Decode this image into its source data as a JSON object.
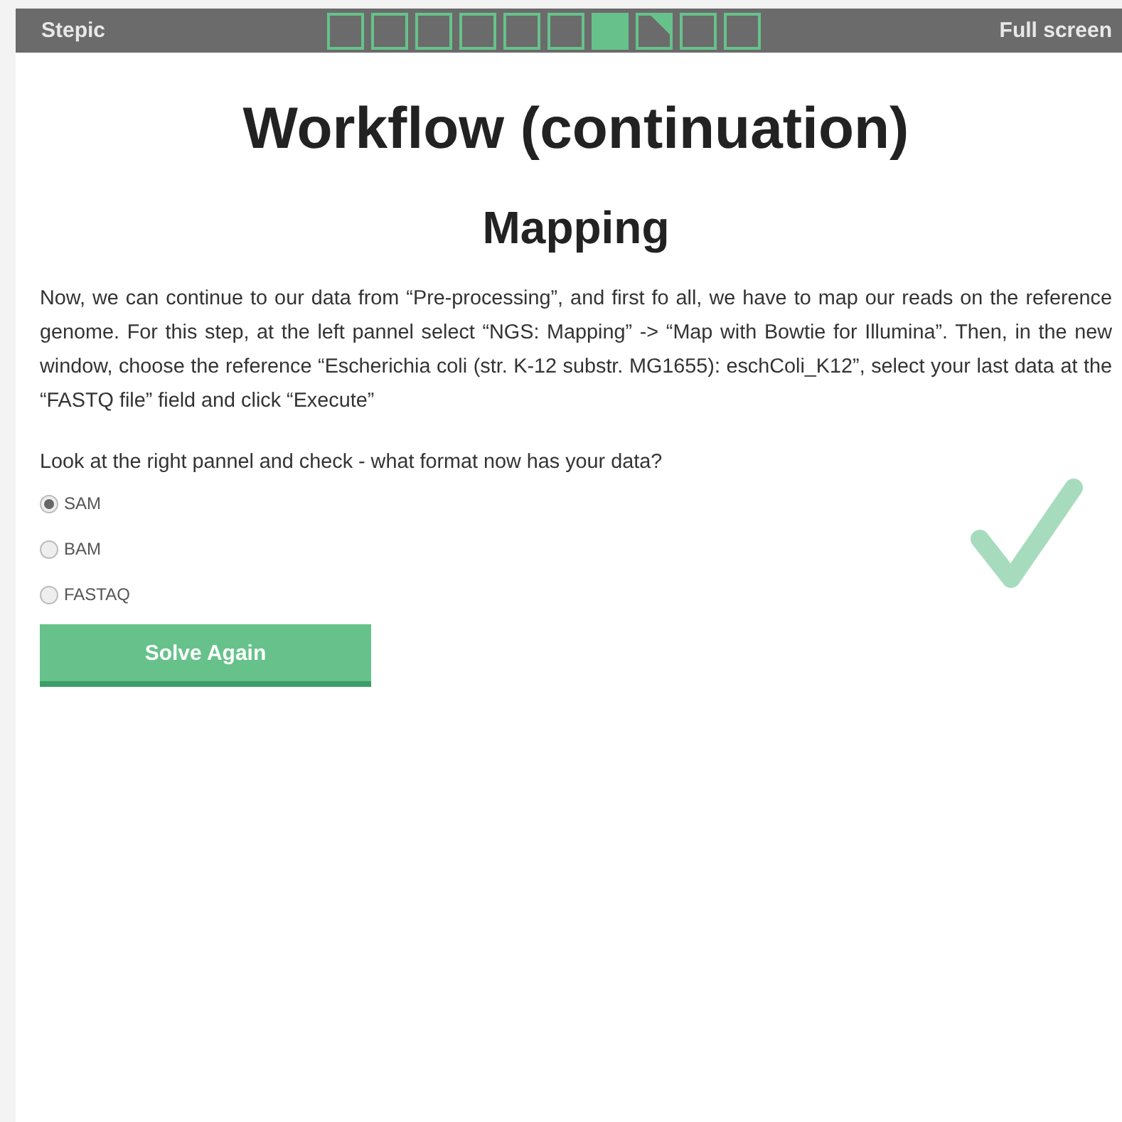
{
  "header": {
    "brand": "Stepic",
    "steps": [
      {
        "kind": "plain",
        "selected": false
      },
      {
        "kind": "plain",
        "selected": false
      },
      {
        "kind": "plain",
        "selected": false
      },
      {
        "kind": "plain",
        "selected": false
      },
      {
        "kind": "plain",
        "selected": false
      },
      {
        "kind": "plain",
        "selected": false
      },
      {
        "kind": "plain",
        "selected": true
      },
      {
        "kind": "folded",
        "selected": false
      },
      {
        "kind": "plain",
        "selected": false
      },
      {
        "kind": "plain",
        "selected": false
      }
    ],
    "fullscreen": "Full screen"
  },
  "title": "Workflow (continuation)",
  "subtitle": "Mapping",
  "paragraph": "Now, we can continue to our data from “Pre-processing”, and first fo all, we have to map our reads on the reference genome. For this step, at the left pannel select “NGS: Mapping” -> “Map with Bowtie for Illumina”. Then, in the new window, choose the reference “Escherichia coli (str. K-12 substr. MG1655): eschColi_K12”, select your last data at the “FASTQ file” field and click “Execute”",
  "question": "Look at the right pannel and check - what format now has your data?",
  "options": [
    {
      "label": "SAM",
      "selected": true
    },
    {
      "label": "BAM",
      "selected": false
    },
    {
      "label": "FASTAQ",
      "selected": false
    }
  ],
  "correct": true,
  "button": "Solve Again"
}
